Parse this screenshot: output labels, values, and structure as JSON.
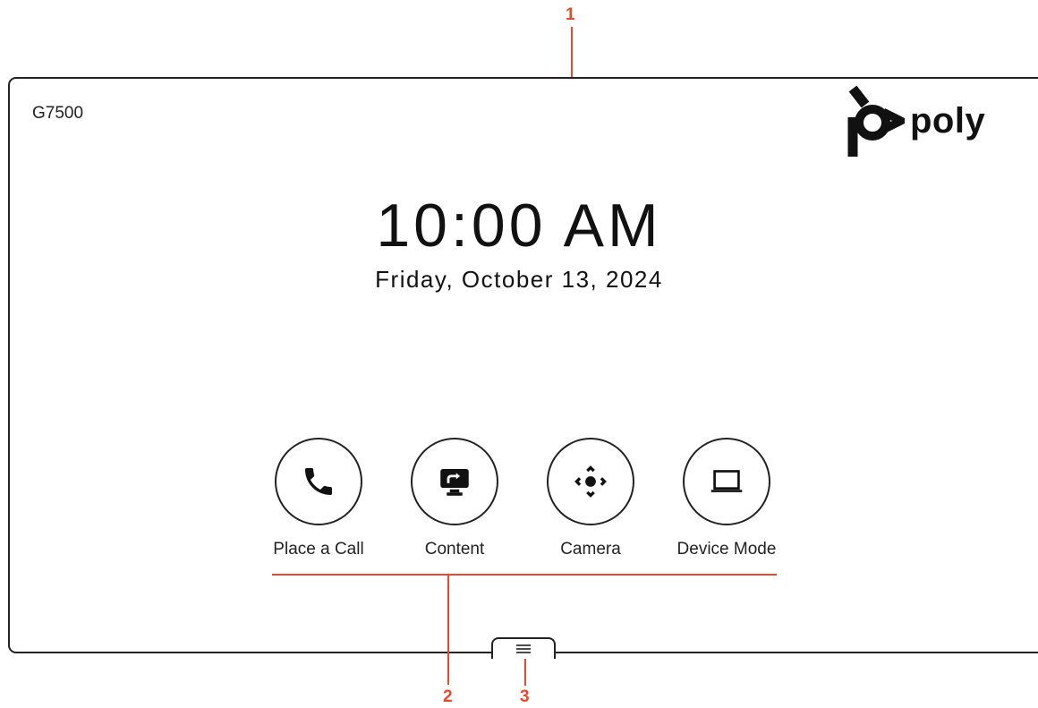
{
  "device": {
    "name": "G7500"
  },
  "brand": {
    "logo_text": "poly"
  },
  "clock": {
    "time": "10:00 AM",
    "date": "Friday, October 13, 2024"
  },
  "actions": [
    {
      "label": "Place a Call",
      "icon": "phone-icon"
    },
    {
      "label": "Content",
      "icon": "screen-share-icon"
    },
    {
      "label": "Camera",
      "icon": "camera-control-icon"
    },
    {
      "label": "Device Mode",
      "icon": "laptop-icon"
    }
  ],
  "menu": {
    "icon": "hamburger-menu-icon"
  },
  "callouts": [
    "1",
    "2",
    "3"
  ],
  "colors": {
    "callout": "#e8492b",
    "frame": "#222222"
  }
}
